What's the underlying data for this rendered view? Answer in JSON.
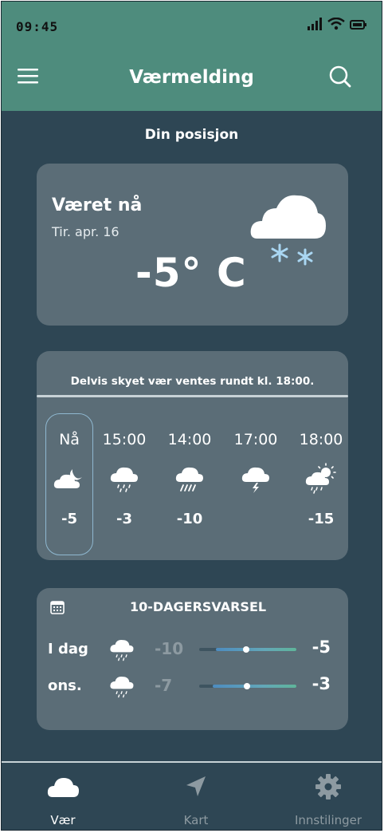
{
  "status": {
    "time": "09:45"
  },
  "header": {
    "title": "Værmelding",
    "menu_icon": "menu-icon",
    "search_icon": "search-icon"
  },
  "location": "Din posisjon",
  "current": {
    "title": "Været nå",
    "date": "Tir. apr. 16",
    "temperature": "-5° C",
    "icon": "cloud-snow-icon"
  },
  "hourly": {
    "summary": "Delvis skyet vær ventes rundt kl. 18:00.",
    "items": [
      {
        "time": "Nå",
        "temp": "-5",
        "icon": "partly-cloudy-night-icon"
      },
      {
        "time": "15:00",
        "temp": "-3",
        "icon": "rain-cloud-icon"
      },
      {
        "time": "14:00",
        "temp": "-10",
        "icon": "heavy-rain-cloud-icon"
      },
      {
        "time": "17:00",
        "temp": "",
        "icon": "thunder-cloud-icon"
      },
      {
        "time": "18:00",
        "temp": "-15",
        "icon": "sun-rain-icon"
      }
    ]
  },
  "forecast": {
    "title": "10-DAGERSVARSEL",
    "days": [
      {
        "day": "I dag",
        "low": "-10",
        "high": "-5",
        "icon": "rain-cloud-icon",
        "range_start": 0.17,
        "range_end": 1.0,
        "current": 0.48
      },
      {
        "day": "ons.",
        "low": "-7",
        "high": "-3",
        "icon": "rain-cloud-icon",
        "range_start": 0.14,
        "range_end": 1.0,
        "current": 0.49
      }
    ]
  },
  "nav": {
    "items": [
      {
        "label": "Vær",
        "icon": "cloud-icon",
        "active": true
      },
      {
        "label": "Kart",
        "icon": "navigation-arrow-icon",
        "active": false
      },
      {
        "label": "Innstilinger",
        "icon": "gear-icon",
        "active": false
      }
    ]
  },
  "colors": {
    "accent": "#4e8c7d",
    "background": "#2e4654",
    "card": "#5b6d77",
    "inactive": "#8d9aa1"
  }
}
